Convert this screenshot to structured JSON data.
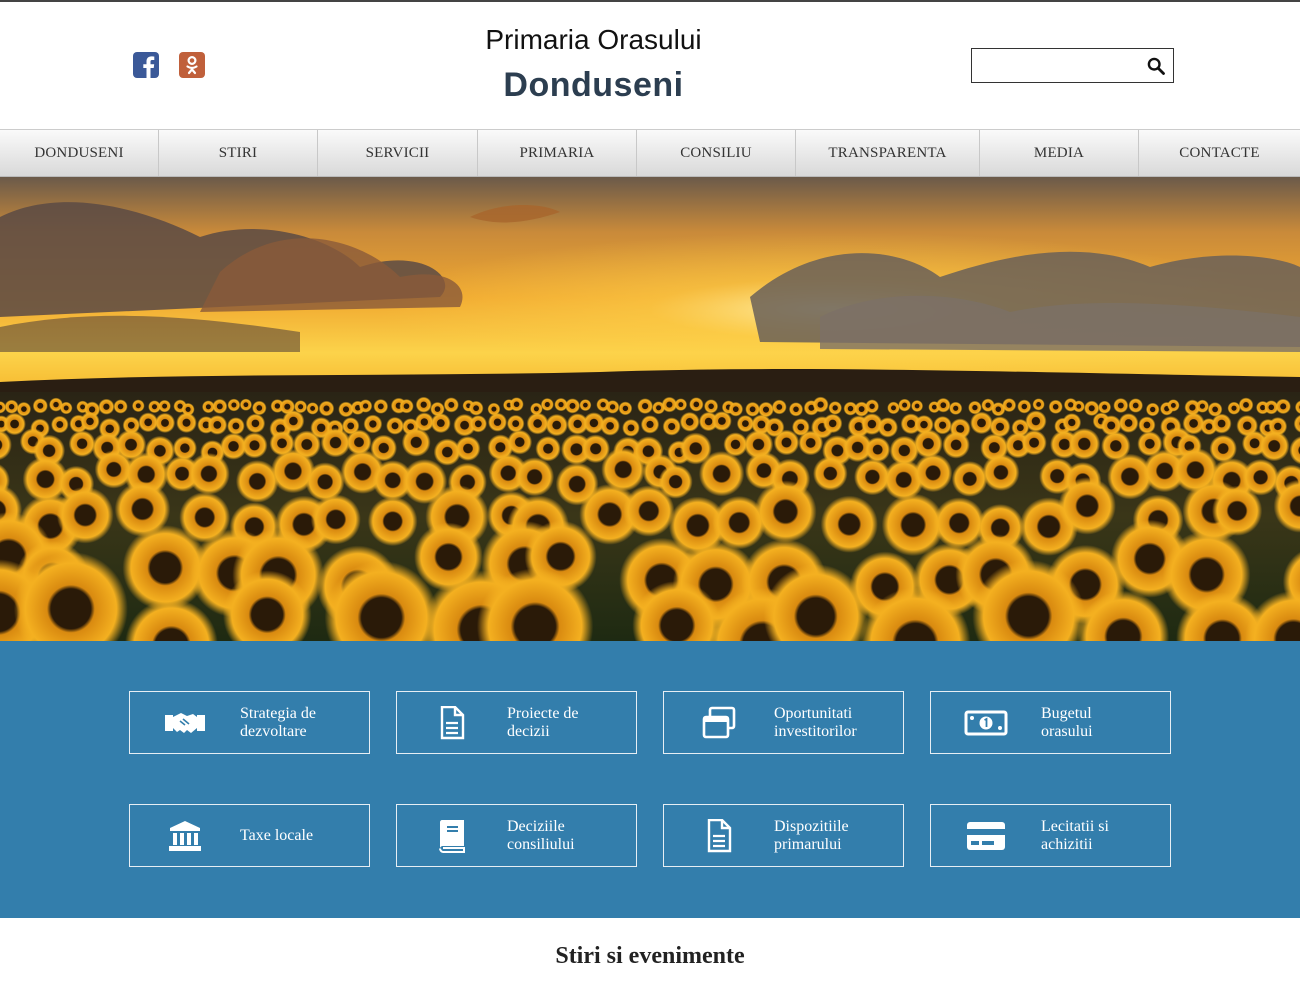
{
  "header": {
    "title_line1": "Primaria Orasului",
    "title_line2": "Donduseni",
    "social": [
      {
        "icon": "facebook-icon",
        "color": "#3b5998"
      },
      {
        "icon": "odnoklassniki-icon",
        "color": "#c0603b"
      }
    ],
    "search": {
      "placeholder": "",
      "value": ""
    }
  },
  "nav": {
    "items": [
      {
        "label": "DONDUSENI"
      },
      {
        "label": "STIRI"
      },
      {
        "label": "SERVICII"
      },
      {
        "label": "PRIMARIA"
      },
      {
        "label": "CONSILIU"
      },
      {
        "label": "TRANSPARENTA"
      },
      {
        "label": "MEDIA"
      },
      {
        "label": "CONTACTE"
      }
    ]
  },
  "hero": {
    "image": "sunflower-field-sunset"
  },
  "services": {
    "background": "#337eac",
    "cards": [
      {
        "label": "Strategia de\ndezvoltare",
        "icon": "handshake-icon"
      },
      {
        "label": "Proiecte de\ndecizii",
        "icon": "document-icon"
      },
      {
        "label": "Oportunitati\ninvestitorilor",
        "icon": "windows-icon"
      },
      {
        "label": "Bugetul\norasului",
        "icon": "money-bill-icon"
      },
      {
        "label": "Taxe locale",
        "icon": "institution-icon"
      },
      {
        "label": "Deciziile\nconsiliului",
        "icon": "book-icon"
      },
      {
        "label": "Dispozitiile\nprimarului",
        "icon": "document-icon"
      },
      {
        "label": "Lecitatii si\nachizitii",
        "icon": "credit-card-icon"
      }
    ]
  },
  "news": {
    "title": "Stiri si evenimente"
  }
}
